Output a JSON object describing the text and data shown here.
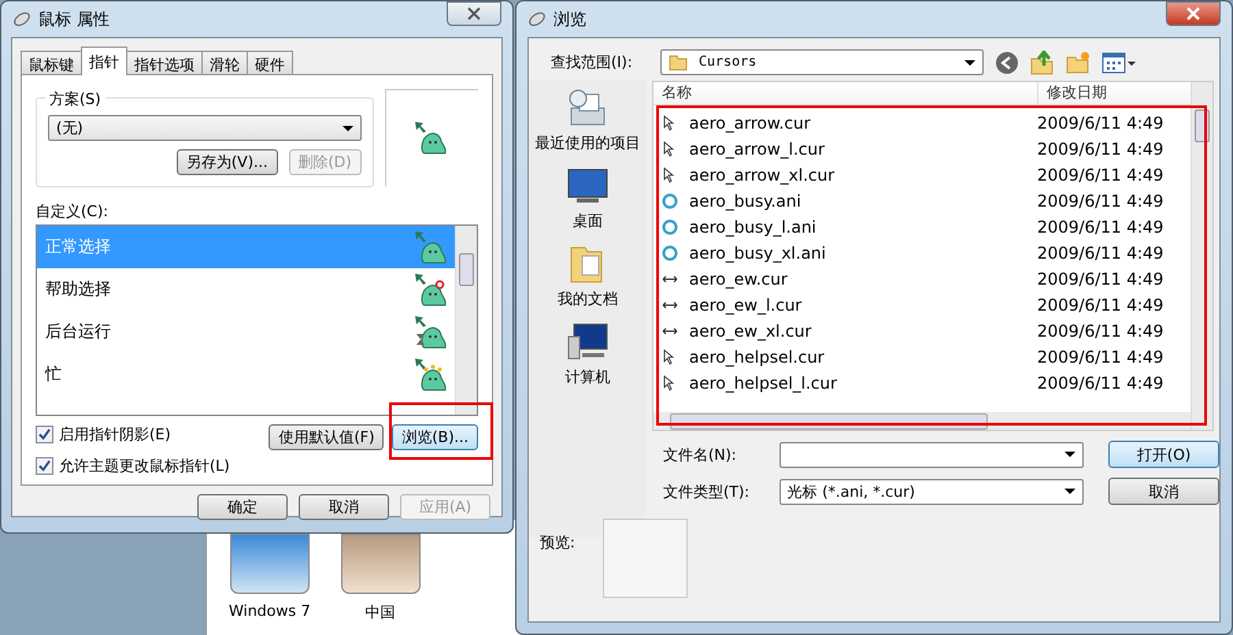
{
  "desktop": {
    "thumbnails": [
      {
        "label": "Windows 7",
        "kind": "blue"
      },
      {
        "label": "中国",
        "kind": "beige"
      }
    ]
  },
  "mouse_dialog": {
    "title": "鼠标 属性",
    "tabs": [
      {
        "label": "鼠标键",
        "selected": false
      },
      {
        "label": "指针",
        "selected": true
      },
      {
        "label": "指针选项",
        "selected": false
      },
      {
        "label": "滑轮",
        "selected": false
      },
      {
        "label": "硬件",
        "selected": false
      }
    ],
    "scheme": {
      "legend": "方案(S)",
      "value": "(无)",
      "buttons": [
        {
          "label": "另存为(V)...",
          "disabled": false
        },
        {
          "label": "删除(D)",
          "disabled": true
        }
      ]
    },
    "customize_label": "自定义(C):",
    "cursors": [
      {
        "name": "正常选择",
        "selected": true,
        "kind": "normal"
      },
      {
        "name": "帮助选择",
        "selected": false,
        "kind": "help"
      },
      {
        "name": "后台运行",
        "selected": false,
        "kind": "working"
      },
      {
        "name": "忙",
        "selected": false,
        "kind": "busy"
      }
    ],
    "checkboxes": [
      {
        "label": "启用指针阴影(E)",
        "checked": true
      },
      {
        "label": "允许主题更改鼠标指针(L)",
        "checked": true
      }
    ],
    "use_default_button": "使用默认值(F)",
    "browse_button": "浏览(B)...",
    "footer_buttons": [
      {
        "label": "确定",
        "disabled": false
      },
      {
        "label": "取消",
        "disabled": false
      },
      {
        "label": "应用(A)",
        "disabled": true
      }
    ]
  },
  "browse_dialog": {
    "title": "浏览",
    "look_in_label": "查找范围(I):",
    "look_in_value": "Cursors",
    "places": [
      {
        "label": "最近使用的项目",
        "kind": "recent"
      },
      {
        "label": "桌面",
        "kind": "desktop"
      },
      {
        "label": "我的文档",
        "kind": "documents"
      },
      {
        "label": "计算机",
        "kind": "computer"
      }
    ],
    "columns": [
      "名称",
      "修改日期"
    ],
    "files": [
      {
        "name": "aero_arrow.cur",
        "modified": "2009/6/11 4:49",
        "kind": "arrow"
      },
      {
        "name": "aero_arrow_l.cur",
        "modified": "2009/6/11 4:49",
        "kind": "arrow"
      },
      {
        "name": "aero_arrow_xl.cur",
        "modified": "2009/6/11 4:49",
        "kind": "arrow"
      },
      {
        "name": "aero_busy.ani",
        "modified": "2009/6/11 4:49",
        "kind": "busy"
      },
      {
        "name": "aero_busy_l.ani",
        "modified": "2009/6/11 4:49",
        "kind": "busy"
      },
      {
        "name": "aero_busy_xl.ani",
        "modified": "2009/6/11 4:49",
        "kind": "busy"
      },
      {
        "name": "aero_ew.cur",
        "modified": "2009/6/11 4:49",
        "kind": "resize"
      },
      {
        "name": "aero_ew_l.cur",
        "modified": "2009/6/11 4:49",
        "kind": "resize"
      },
      {
        "name": "aero_ew_xl.cur",
        "modified": "2009/6/11 4:49",
        "kind": "resize"
      },
      {
        "name": "aero_helpsel.cur",
        "modified": "2009/6/11 4:49",
        "kind": "arrow"
      },
      {
        "name": "aero_helpsel_l.cur",
        "modified": "2009/6/11 4:49",
        "kind": "arrow"
      }
    ],
    "file_name_label": "文件名(N):",
    "file_type_label": "文件类型(T):",
    "file_type_value": "光标 (*.ani, *.cur)",
    "open_button": "打开(O)",
    "cancel_button": "取消",
    "preview_label": "预览:"
  }
}
